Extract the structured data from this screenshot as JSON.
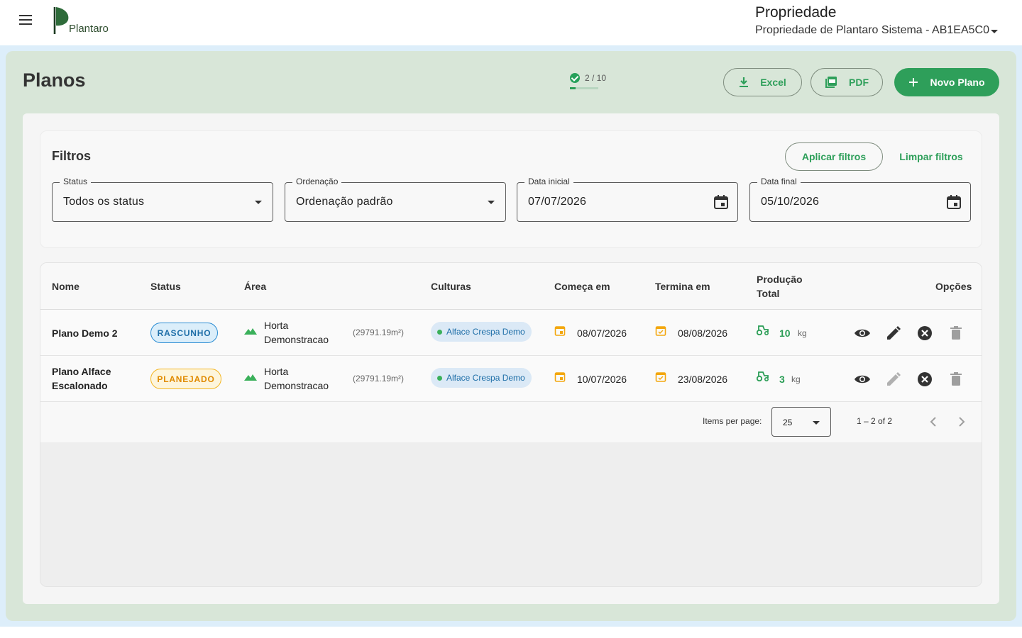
{
  "header": {
    "logo_text": "Plantaro",
    "property_title": "Propriedade",
    "property_name": "Propriedade de Plantaro Sistema - AB1EA5C0"
  },
  "page": {
    "title": "Planos",
    "progress_text": "2 / 10",
    "progress_fraction": 0.2,
    "excel_label": "Excel",
    "pdf_label": "PDF",
    "new_label": "Novo Plano"
  },
  "filters": {
    "title": "Filtros",
    "apply_label": "Aplicar filtros",
    "clear_label": "Limpar filtros",
    "status": {
      "label": "Status",
      "value": "Todos os status"
    },
    "order": {
      "label": "Ordenação",
      "value": "Ordenação padrão"
    },
    "start": {
      "label": "Data inicial",
      "value": "07/07/2026"
    },
    "end": {
      "label": "Data final",
      "value": "05/10/2026"
    }
  },
  "table": {
    "headers": {
      "name": "Nome",
      "status": "Status",
      "area": "Área",
      "cultures": "Culturas",
      "start": "Começa em",
      "end": "Termina em",
      "production_1": "Produção",
      "production_2": "Total",
      "options": "Opções"
    },
    "rows": [
      {
        "name": "Plano Demo 2",
        "status": "RASCUNHO",
        "area_line1": "Horta",
        "area_line2": "Demonstracao",
        "area_size": "(29791.19m²)",
        "culture": "Alface Crespa Demo",
        "start": "08/07/2026",
        "end": "08/08/2026",
        "production": "10",
        "unit": "kg"
      },
      {
        "name_line1": "Plano Alface",
        "name_line2": "Escalonado",
        "status": "PLANEJADO",
        "area_line1": "Horta",
        "area_line2": "Demonstracao",
        "area_size": "(29791.19m²)",
        "culture": "Alface Crespa Demo",
        "start": "10/07/2026",
        "end": "23/08/2026",
        "production": "3",
        "unit": "kg"
      }
    ]
  },
  "pager": {
    "items_per_page_label": "Items per page:",
    "page_size": "25",
    "range": "1 – 2 of 2"
  },
  "colors": {
    "accent": "#2e9f5a",
    "draft": "#2d8ed4",
    "planned": "#f3b623",
    "calendar": "#f3a70f"
  }
}
